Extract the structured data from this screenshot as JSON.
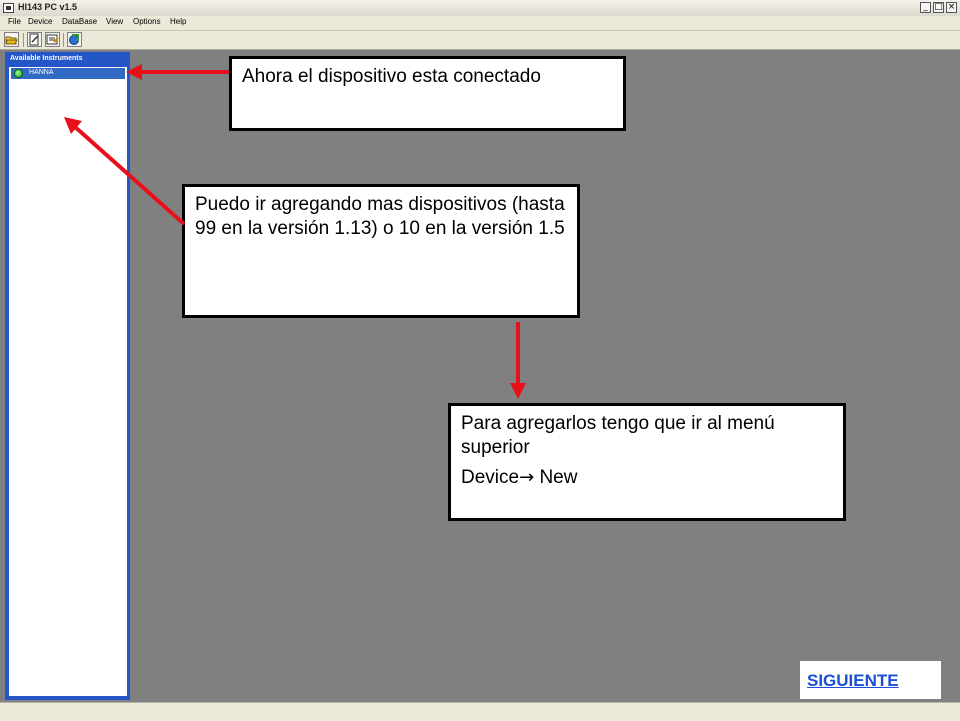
{
  "window": {
    "title": "HI143 PC v1.5",
    "buttons": [
      "minimize",
      "maximize",
      "close"
    ]
  },
  "menubar": {
    "items": [
      "File",
      "Device",
      "DataBase",
      "View",
      "Options",
      "Help"
    ]
  },
  "toolbar": {
    "buttons": [
      "open-icon",
      "edit-icon",
      "download-icon",
      "export-icon"
    ]
  },
  "sidebar": {
    "title": "Available Instruments",
    "instruments": [
      {
        "name": "HANNA",
        "status": "connected",
        "status_color": "#1da017"
      }
    ]
  },
  "callouts": {
    "connected": "Ahora el dispositivo esta conectado",
    "add_more": "Puedo ir agregando mas dispositivos  (hasta 99 en la versión 1.13) o 10 en la versión 1.5",
    "how_to_line1": "Para agregarlos tengo que ir al menú superior",
    "how_to_device": "Device",
    "how_to_new": " New"
  },
  "next_link": "SIGUIENTE",
  "colors": {
    "arrow": "#e8101a",
    "sidebar": "#2456c8",
    "workspace": "#808080",
    "link": "#1a4fd6"
  }
}
